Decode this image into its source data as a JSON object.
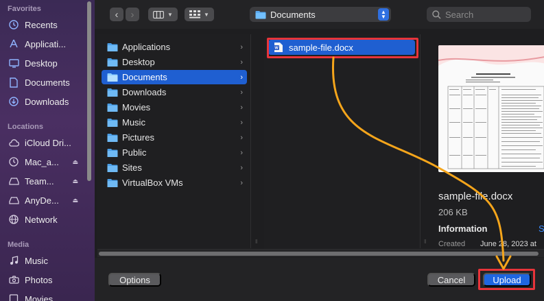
{
  "sidebar": {
    "favorites_label": "Favorites",
    "favorites": [
      {
        "label": "Recents",
        "icon": "clock-icon"
      },
      {
        "label": "Applicati...",
        "icon": "applications-icon"
      },
      {
        "label": "Desktop",
        "icon": "desktop-icon"
      },
      {
        "label": "Documents",
        "icon": "document-icon"
      },
      {
        "label": "Downloads",
        "icon": "download-icon"
      }
    ],
    "locations_label": "Locations",
    "locations": [
      {
        "label": "iCloud Dri...",
        "icon": "cloud-icon"
      },
      {
        "label": "Mac_a...",
        "icon": "clock-disk-icon"
      },
      {
        "label": "Team...",
        "icon": "drive-icon"
      },
      {
        "label": "AnyDe...",
        "icon": "drive-icon"
      },
      {
        "label": "Network",
        "icon": "globe-icon"
      }
    ],
    "media_label": "Media",
    "media": [
      {
        "label": "Music",
        "icon": "music-icon"
      },
      {
        "label": "Photos",
        "icon": "camera-icon"
      },
      {
        "label": "Movies",
        "icon": "film-icon"
      }
    ]
  },
  "toolbar": {
    "back": "‹",
    "forward": "›",
    "path_label": "Documents",
    "search_placeholder": "Search"
  },
  "folders": [
    {
      "label": "Applications",
      "selected": false
    },
    {
      "label": "Desktop",
      "selected": false
    },
    {
      "label": "Documents",
      "selected": true
    },
    {
      "label": "Downloads",
      "selected": false
    },
    {
      "label": "Movies",
      "selected": false
    },
    {
      "label": "Music",
      "selected": false
    },
    {
      "label": "Pictures",
      "selected": false
    },
    {
      "label": "Public",
      "selected": false
    },
    {
      "label": "Sites",
      "selected": false
    },
    {
      "label": "VirtualBox VMs",
      "selected": false
    }
  ],
  "files": [
    {
      "label": "sample-file.docx",
      "selected": true
    }
  ],
  "preview": {
    "name": "sample-file.docx",
    "size": "206 KB",
    "info_label": "Information",
    "show_more": "S",
    "created_label": "Created",
    "created_value": "June 28, 2023 at"
  },
  "footer": {
    "options_label": "Options",
    "cancel_label": "Cancel",
    "upload_label": "Upload"
  },
  "colors": {
    "accent": "#1f5fd1",
    "highlight": "#e8343a",
    "arrow": "#f5a51b"
  }
}
